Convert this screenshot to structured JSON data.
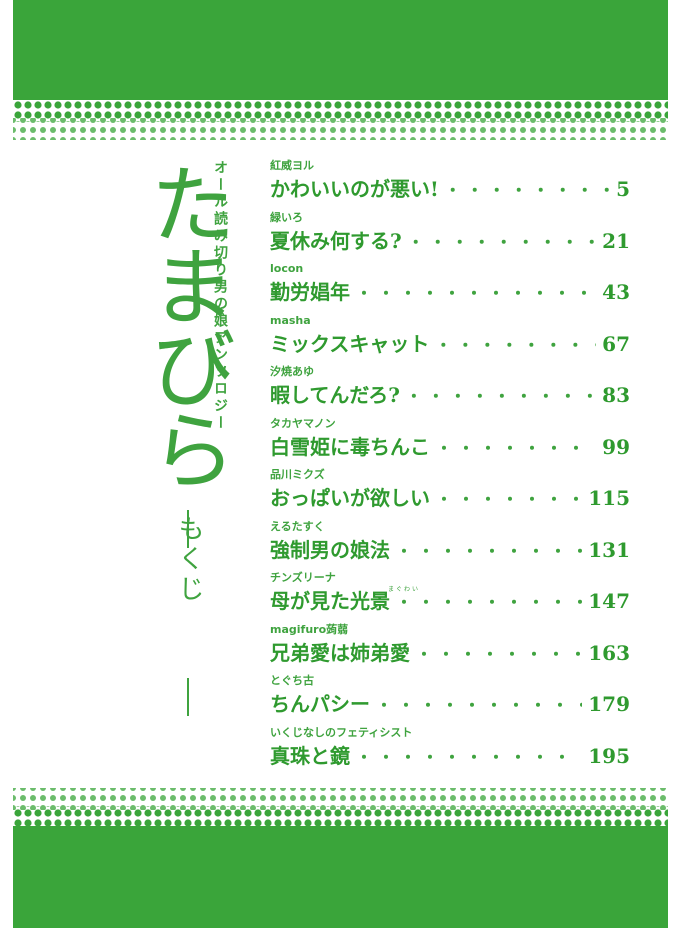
{
  "book": {
    "title": "たまびら",
    "subtitle": "オール読み切り男の娘アンソロジー",
    "contents_label": "もくじ"
  },
  "toc": [
    {
      "author": "紅威ヨル",
      "title": "かわいいのが悪い!",
      "page": "5"
    },
    {
      "author": "緑いろ",
      "title": "夏休み何する?",
      "page": "21"
    },
    {
      "author": "locon",
      "title": "勤労娼年",
      "page": "43"
    },
    {
      "author": "masha",
      "title": "ミックスキャット",
      "page": "67"
    },
    {
      "author": "汐焼あゆ",
      "title": "暇してんだろ?",
      "page": "83"
    },
    {
      "author": "タカヤマノン",
      "title": "白雪姫に毒ちんこ",
      "page": "99"
    },
    {
      "author": "品川ミクズ",
      "title": "おっぱいが欲しい",
      "page": "115"
    },
    {
      "author": "えるたすく",
      "title": "強制男の娘法",
      "page": "131"
    },
    {
      "author": "チンズリーナ",
      "title": "母が見た光景",
      "page": "147",
      "ruby": "まぐわい"
    },
    {
      "author": "magifuro蒟蒻",
      "title": "兄弟愛は姉弟愛",
      "page": "163"
    },
    {
      "author": "とぐち古",
      "title": "ちんパシー",
      "page": "179"
    },
    {
      "author": "いくじなしのフェティシスト",
      "title": "真珠と鏡",
      "page": "195"
    }
  ],
  "colors": {
    "accent": "#3aa53a"
  }
}
